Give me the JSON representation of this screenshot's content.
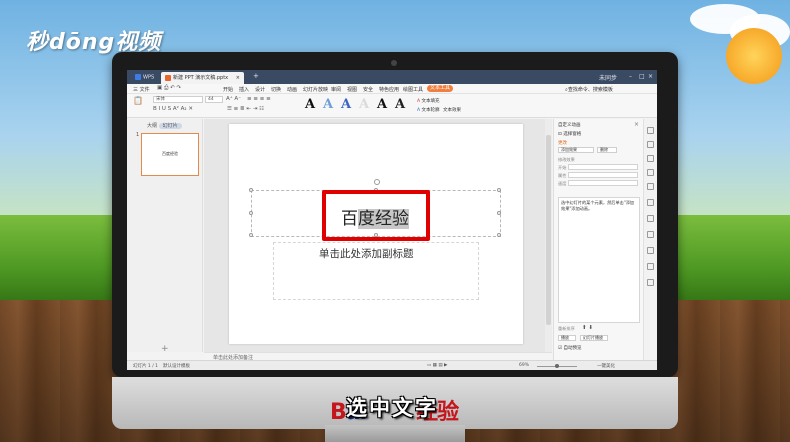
{
  "brand": {
    "watermark": "秒dōng视频"
  },
  "window": {
    "tabs": [
      {
        "label": "WPS"
      },
      {
        "label": "新建 PPT 演示文稿.pptx"
      }
    ],
    "menu": [
      "三 文件",
      "开始",
      "插入",
      "设计",
      "切换",
      "动画",
      "幻灯片放映",
      "审阅",
      "视图",
      "安全",
      "特色应用",
      "绘图工具",
      "文本工具"
    ],
    "right_hint": "未同步",
    "search_hint": "查找命令、搜索模板"
  },
  "toolbar": {
    "font_name": "宋体",
    "font_size": "44",
    "art_letters": [
      "A",
      "A",
      "A",
      "A",
      "A",
      "A"
    ],
    "text_fill": "文本填充",
    "text_outline": "文本轮廓",
    "text_effect": "文本效果"
  },
  "left_panel": {
    "tab_outline": "大纲",
    "tab_slides": "幻灯片",
    "slide_number": "1",
    "thumb_title": "百度经验"
  },
  "slide": {
    "title_plain": "百",
    "title_selected": "度经验",
    "subtitle_placeholder": "单击此处添加副标题"
  },
  "notes": {
    "placeholder": "单击此处添加备注"
  },
  "right_panel": {
    "title": "自定义动画",
    "select_pane": "选择窗格",
    "change": "更改",
    "add_effect": "添加效果",
    "delete": "删除",
    "modify_label": "修改效果",
    "start_label": "开始",
    "property_label": "属性",
    "speed_label": "速度",
    "list_text": "选中幻灯片的某个元素，然后单击\"添加效果\"添加动画。",
    "reorder": "重新排序",
    "play": "播放",
    "show": "幻灯片播放",
    "autopreview": "自动预览"
  },
  "status": {
    "slide_info": "幻灯片 1 / 1",
    "theme": "默认设计模板",
    "zoom": "69%",
    "beautify": "一键美化"
  },
  "caption": {
    "logo_left": "B",
    "logo_paw": "ai",
    "logo_right": "经验",
    "text": "选中文字"
  }
}
